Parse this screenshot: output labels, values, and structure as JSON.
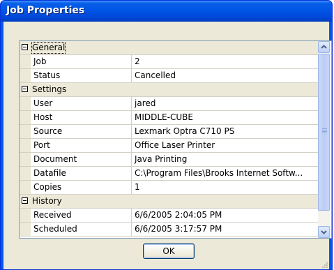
{
  "window": {
    "title": "Job Properties"
  },
  "properties": [
    {
      "type": "category",
      "label": "General"
    },
    {
      "type": "item",
      "name": "Job",
      "value": "2"
    },
    {
      "type": "item",
      "name": "Status",
      "value": "Cancelled"
    },
    {
      "type": "category",
      "label": "Settings"
    },
    {
      "type": "item",
      "name": "User",
      "value": "jared"
    },
    {
      "type": "item",
      "name": "Host",
      "value": "MIDDLE-CUBE"
    },
    {
      "type": "item",
      "name": "Source",
      "value": "Lexmark Optra C710 PS"
    },
    {
      "type": "item",
      "name": "Port",
      "value": "Office Laser Printer"
    },
    {
      "type": "item",
      "name": "Document",
      "value": "Java Printing"
    },
    {
      "type": "item",
      "name": "Datafile",
      "value": "C:\\Program Files\\Brooks Internet Softw..."
    },
    {
      "type": "item",
      "name": "Copies",
      "value": "1"
    },
    {
      "type": "category",
      "label": "History"
    },
    {
      "type": "item",
      "name": "Received",
      "value": "6/6/2005 2:04:05 PM"
    },
    {
      "type": "item",
      "name": "Scheduled",
      "value": "6/6/2005 3:17:57 PM"
    }
  ],
  "buttons": {
    "ok_label": "OK"
  },
  "icons": {
    "collapse": "minus-box-icon",
    "scroll_up": "chevron-up-icon",
    "scroll_down": "chevron-down-icon",
    "resize": "size-grip-icon"
  },
  "colors": {
    "titlebar": "#0055e5",
    "dialog_bg": "#ece9d8",
    "grid_line": "#d4d0c8",
    "scrollbar": "#bacdf6",
    "button_border": "#003c74"
  }
}
